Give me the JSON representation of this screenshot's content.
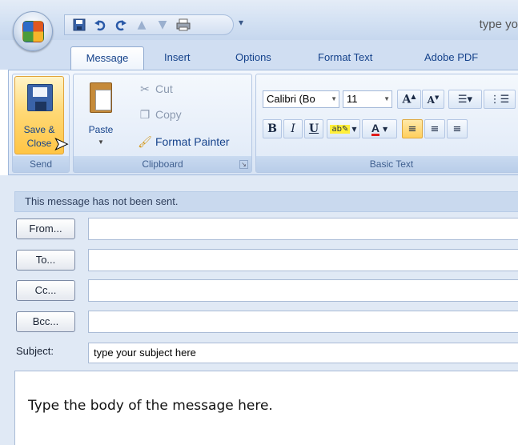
{
  "window": {
    "title": "type yo"
  },
  "quick_access": {
    "icons": [
      "save-icon",
      "undo-icon",
      "redo-icon",
      "previous-item-icon",
      "next-item-icon",
      "print-icon"
    ],
    "customize": "▾"
  },
  "tabs": [
    {
      "label": "Message",
      "active": true
    },
    {
      "label": "Insert"
    },
    {
      "label": "Options"
    },
    {
      "label": "Format Text"
    },
    {
      "label": "Adobe PDF"
    }
  ],
  "ribbon": {
    "send": {
      "save_line1": "Save &",
      "save_line2": "Close",
      "group": "Send"
    },
    "clipboard": {
      "paste": "Paste",
      "cut": "Cut",
      "copy": "Copy",
      "format_painter": "Format Painter",
      "group": "Clipboard"
    },
    "basic_text": {
      "font": "Calibri (Bo",
      "size": "11",
      "bold": "B",
      "italic": "I",
      "underline": "U",
      "group": "Basic Text"
    }
  },
  "message": {
    "info": "This message has not been sent.",
    "from_btn": "From...",
    "to_btn": "To...",
    "cc_btn": "Cc...",
    "bcc_btn": "Bcc...",
    "subject_label": "Subject:",
    "subject_value": "type your subject here",
    "body": "Type the body of the message here."
  },
  "colors": {
    "accent": "#15428b",
    "highlight": "#ffd976",
    "form_bg": "#e0e9f5"
  }
}
